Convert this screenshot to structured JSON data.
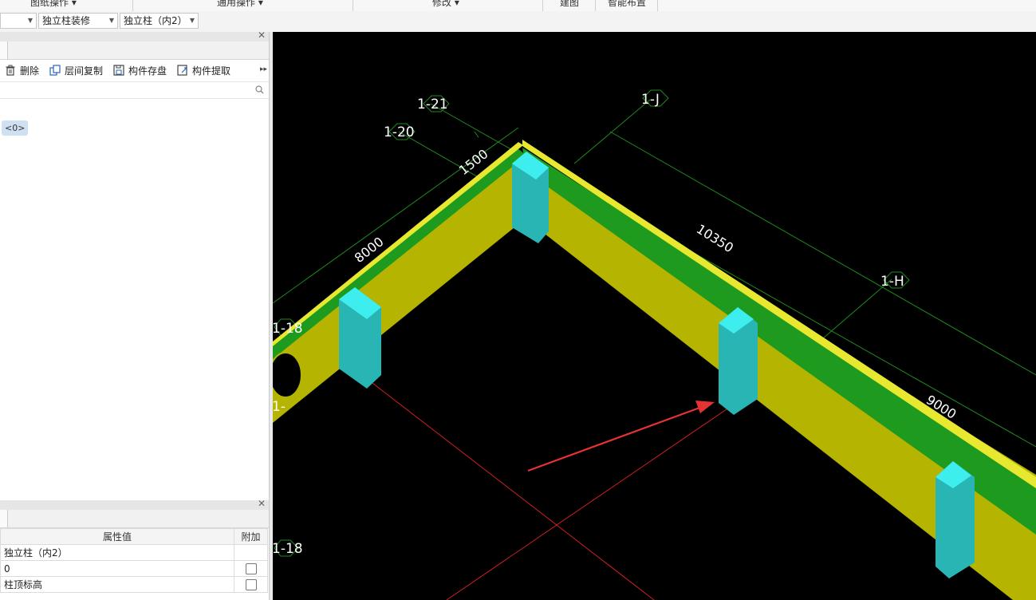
{
  "ribbon": {
    "groups": [
      "图纸操作 ▾",
      "通用操作 ▾",
      "修改 ▾",
      "建图",
      "智能布置"
    ]
  },
  "toolbar2": {
    "combo_blank": "",
    "combo_category": "独立柱装修",
    "combo_component": "独立柱（内2）"
  },
  "component_panel": {
    "buttons": {
      "delete": "删除",
      "floor_copy": "层间复制",
      "save_component": "构件存盘",
      "extract_component": "构件提取"
    },
    "search_placeholder": "",
    "tree_tag": "<0>"
  },
  "property_panel": {
    "header": {
      "value": "属性值",
      "extra": "附加"
    },
    "rows": [
      {
        "value": "独立柱（内2）",
        "has_checkbox": false
      },
      {
        "value": "0",
        "has_checkbox": true
      },
      {
        "value": "柱顶标高",
        "has_checkbox": true
      }
    ]
  },
  "viewport": {
    "axis_labels": {
      "a121": "1-21",
      "a120": "1-20",
      "a1J": "1-J",
      "a1H": "1-H",
      "a118a": "1-18",
      "a118b": "1-18",
      "a1partial": "1-"
    },
    "dimensions": {
      "d1500": "1500",
      "d8000": "8000",
      "d10350": "10350",
      "d9000": "9000"
    },
    "colors": {
      "background": "#000000",
      "wall": "#b5b400",
      "wall_top": "#1e9a1e",
      "column": "#2ab5b5",
      "column_top": "#3eeeee",
      "axis_line": "#1e8a1e",
      "grid_line": "#d01f1f",
      "annotation_arrow": "#e53232"
    }
  }
}
